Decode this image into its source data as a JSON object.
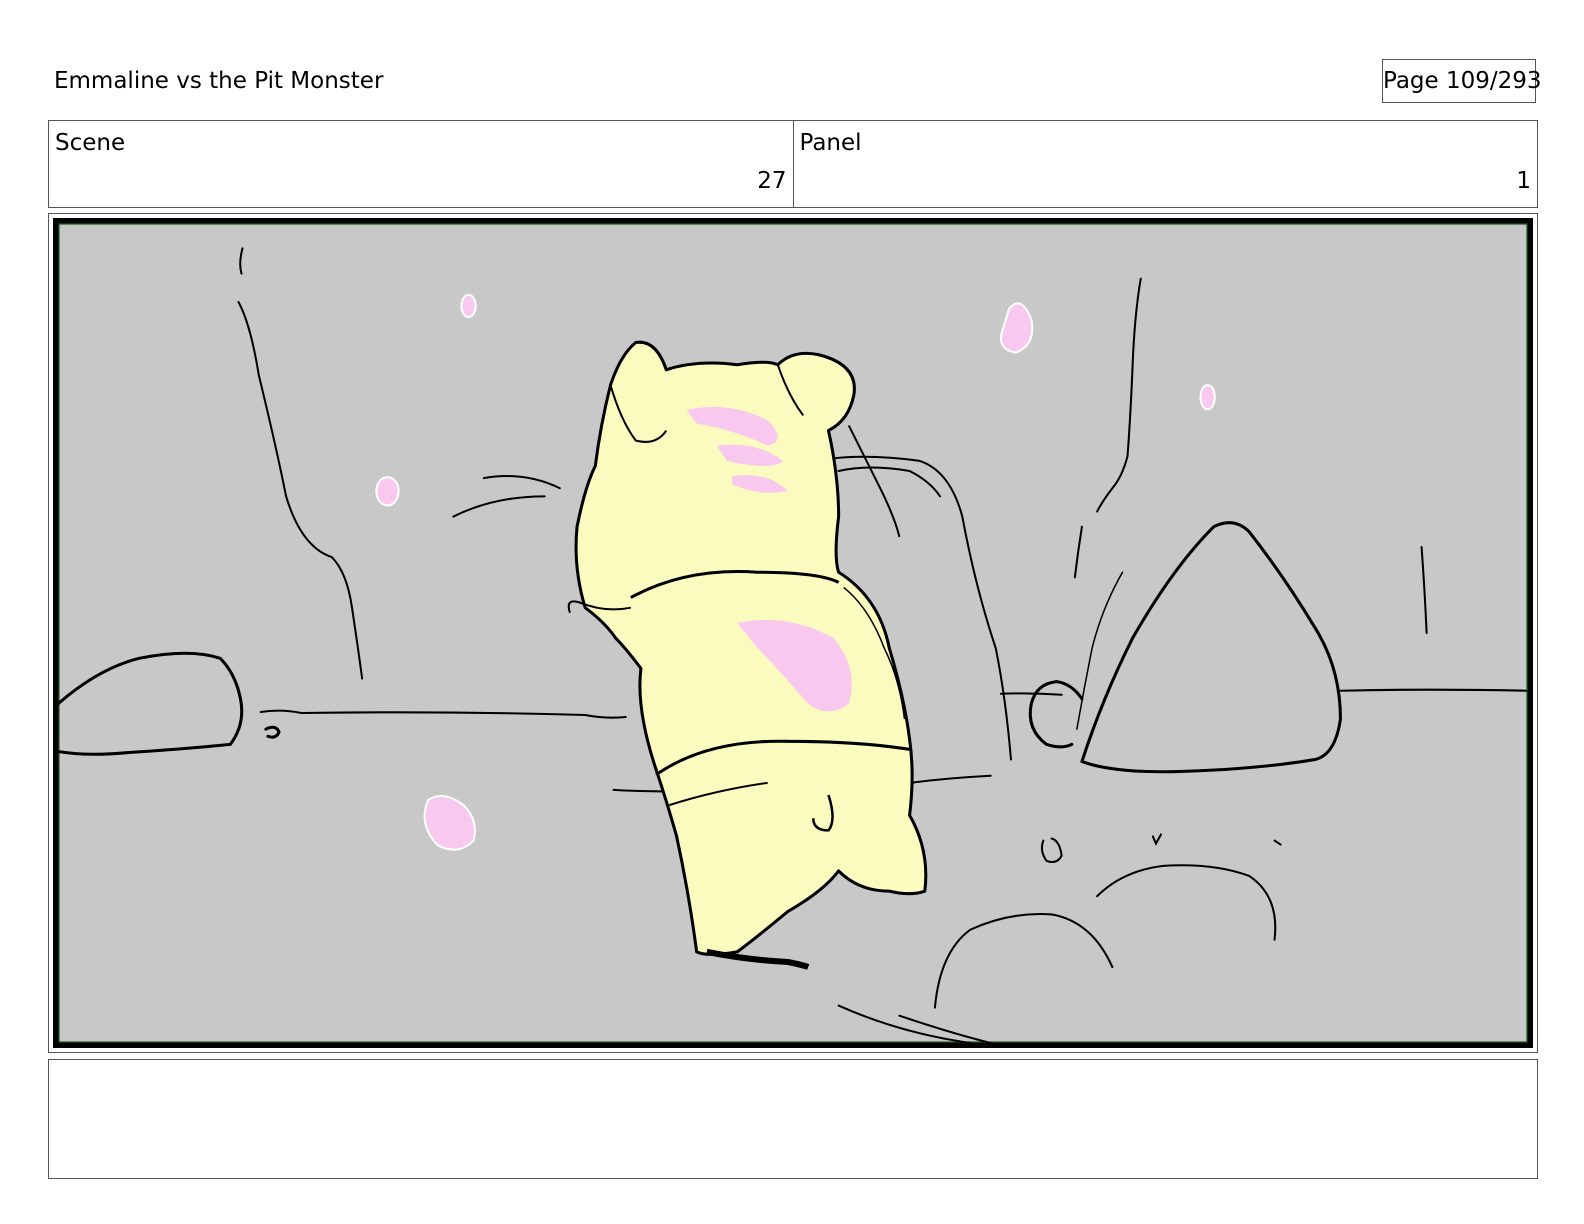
{
  "header": {
    "project_title": "Emmaline vs the Pit Monster",
    "page_label": "Page 109/293"
  },
  "info": {
    "scene_label": "Scene",
    "scene_value": "27",
    "panel_label": "Panel",
    "panel_value": "1"
  },
  "panel_image": {
    "description_icon": "storyboard-drawing",
    "colors": {
      "background": "#c8c8c8",
      "frame": "#000000",
      "frame_accent": "#0b3d0b",
      "character_fill": "#fbfbbf",
      "blossom_fill": "#f8c8ef",
      "line": "#000000"
    }
  },
  "notes": {
    "text": ""
  }
}
